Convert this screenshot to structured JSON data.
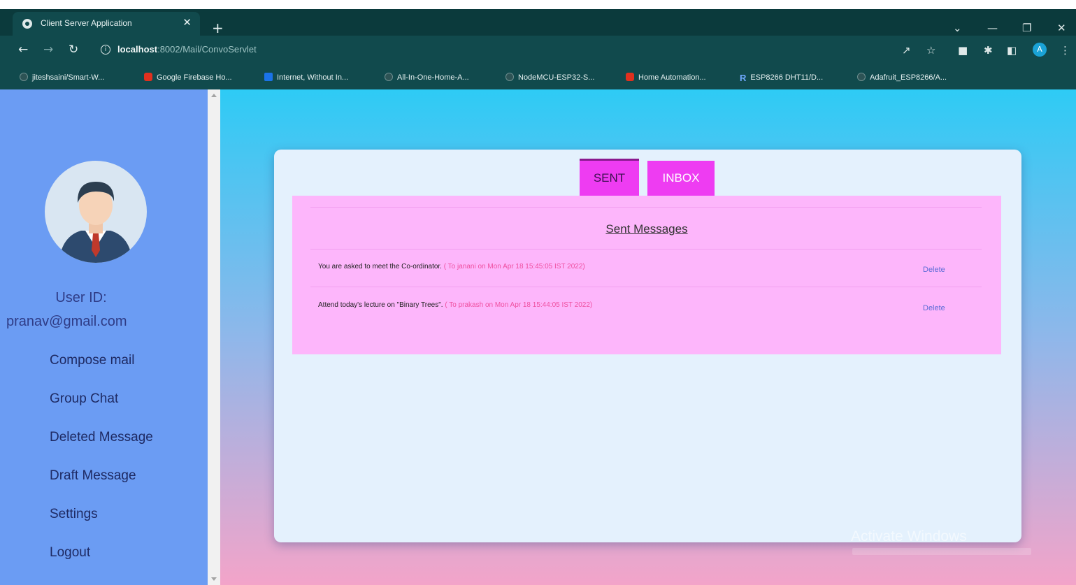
{
  "browser": {
    "tab_title": "Client Server Application",
    "tab_close": "✕",
    "new_tab": "+",
    "url_host": "localhost",
    "url_path": ":8002/Mail/ConvoServlet",
    "bookmarks": [
      {
        "label": "jiteshsaini/Smart-W...",
        "icon": "github-icon"
      },
      {
        "label": "Google Firebase Ho...",
        "icon": "youtube-icon"
      },
      {
        "label": "Internet, Without In...",
        "icon": "bookmark-icon"
      },
      {
        "label": "All-In-One-Home-A...",
        "icon": "github-icon"
      },
      {
        "label": "NodeMCU-ESP32-S...",
        "icon": "github-icon"
      },
      {
        "label": "Home Automation...",
        "icon": "youtube-icon"
      },
      {
        "label": "ESP8266 DHT11/D...",
        "icon": "r-icon"
      },
      {
        "label": "Adafruit_ESP8266/A...",
        "icon": "github-icon"
      }
    ],
    "profile_initial": "A",
    "r_glyph": "R"
  },
  "sidebar": {
    "userid_label": "User ID:",
    "userid_value": "pranav@gmail.com",
    "items": [
      {
        "label": "Compose mail"
      },
      {
        "label": "Group Chat"
      },
      {
        "label": "Deleted Message"
      },
      {
        "label": "Draft Message"
      },
      {
        "label": "Settings"
      },
      {
        "label": "Logout"
      }
    ]
  },
  "main": {
    "tabs": [
      {
        "label": "SENT"
      },
      {
        "label": "INBOX"
      }
    ],
    "heading": "Sent Messages",
    "messages": [
      {
        "text": "You are asked to meet the Co-ordinator.",
        "meta": " ( To janani on Mon Apr 18 15:45:05 IST 2022)",
        "action": "Delete"
      },
      {
        "text": "Attend today's lecture on \"Binary Trees\".",
        "meta": " ( To prakash on Mon Apr 18 15:44:05 IST 2022)",
        "action": "Delete"
      }
    ]
  },
  "watermark": "Activate Windows",
  "colors": {
    "sidebar": "#6b9cf3",
    "tab": "#ee3cf2",
    "panel": "#fdb6fb",
    "card": "#e4f1fd"
  }
}
